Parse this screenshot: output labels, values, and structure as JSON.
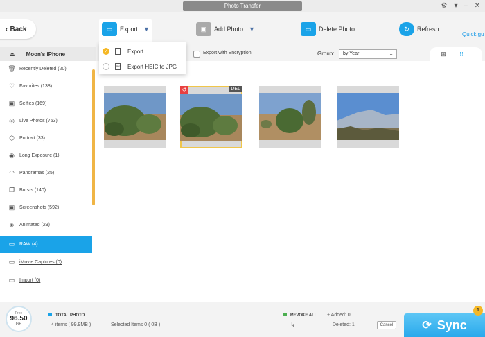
{
  "window": {
    "title": "Photo Transfer"
  },
  "toolbar": {
    "back_label": "Back",
    "export_label": "Export",
    "add_photo_label": "Add Photo",
    "delete_photo_label": "Delete Photo",
    "refresh_label": "Refresh",
    "quick_guide_label": "Quick gu"
  },
  "export_menu": {
    "items": [
      {
        "label": "Export",
        "selected": true
      },
      {
        "label": "Export HEIC to JPG",
        "selected": false
      }
    ]
  },
  "sidebar": {
    "device_name": "Moon's iPhone",
    "items": [
      {
        "label": "Recently Deleted (20)",
        "icon": "trash-icon"
      },
      {
        "label": "Favorites (138)",
        "icon": "heart-icon"
      },
      {
        "label": "Selfies (169)",
        "icon": "person-icon"
      },
      {
        "label": "Live Photos (753)",
        "icon": "live-photo-icon"
      },
      {
        "label": "Portrait (33)",
        "icon": "cube-icon"
      },
      {
        "label": "Long Exposure (1)",
        "icon": "long-exposure-icon"
      },
      {
        "label": "Panoramas (25)",
        "icon": "panorama-icon"
      },
      {
        "label": "Bursts (140)",
        "icon": "bursts-icon"
      },
      {
        "label": "Screenshots (592)",
        "icon": "screenshot-icon"
      },
      {
        "label": "Animated (29)",
        "icon": "animated-icon"
      },
      {
        "label": "RAW (4)",
        "icon": "raw-icon"
      },
      {
        "label": "iMovie Captures (0)",
        "icon": "imovie-icon"
      },
      {
        "label": "Import (0)",
        "icon": "import-icon"
      }
    ]
  },
  "filter": {
    "encryption_label": "Export with Encryption",
    "group_label": "Group:",
    "group_value": "by Year"
  },
  "photos": [
    {
      "selected": false,
      "badge": ""
    },
    {
      "selected": true,
      "badge": "DEL"
    },
    {
      "selected": false,
      "badge": ""
    },
    {
      "selected": false,
      "badge": ""
    }
  ],
  "footer": {
    "storage_label": "Free",
    "storage_value": "96.50",
    "storage_unit": "GB",
    "total_photo_label": "TOTAL PHOTO",
    "items_text": "4 items ( 99.9MB )",
    "selected_text": "Selected Items 0 ( 0B )",
    "revoke_all_label": "REVOKE ALL",
    "added_text": "Added: 0",
    "deleted_text": "Deleted: 1",
    "cancel_label": "Cancel",
    "sync_label": "Sync",
    "sync_badge": "1"
  },
  "colors": {
    "accent": "#1aa3e8",
    "selected_border": "#f0c64a",
    "scroll": "#f0b545",
    "revoke_green": "#4caf50"
  }
}
